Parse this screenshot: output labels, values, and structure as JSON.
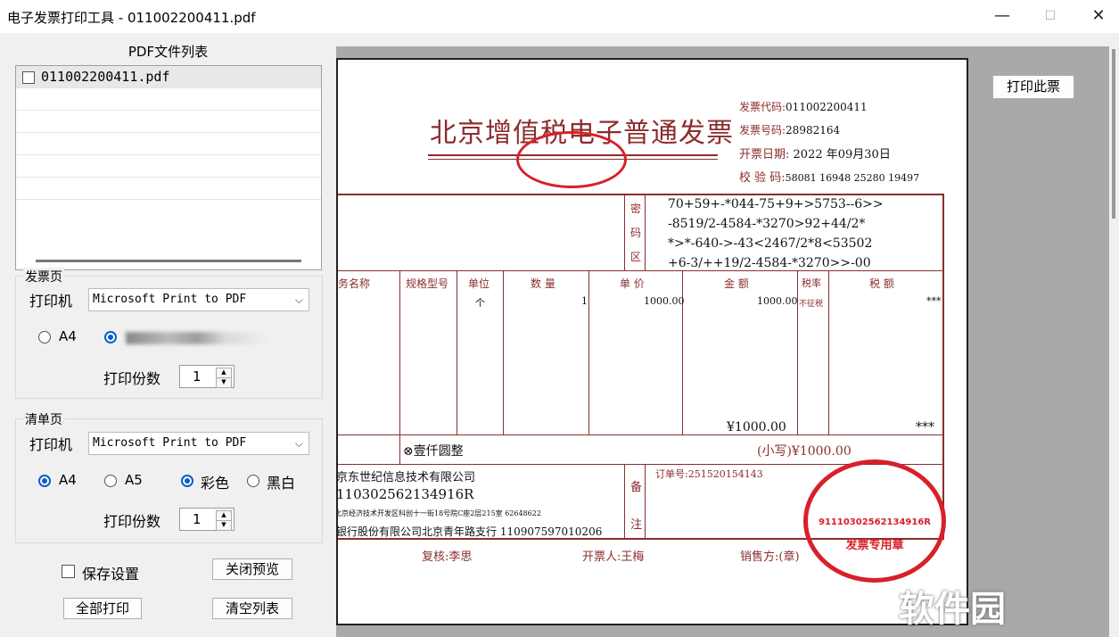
{
  "window": {
    "title": "电子发票打印工具 - 011002200411.pdf",
    "minimize": "—",
    "maximize": "☐",
    "close": "✕"
  },
  "file_list": {
    "title": "PDF文件列表",
    "items": [
      {
        "label": "011002200411.pdf",
        "checked": false
      }
    ]
  },
  "invoice_page": {
    "group_label": "发票页",
    "printer_label": "打印机",
    "printer_value": "Microsoft Print to PDF",
    "paper_options": [
      "A4"
    ],
    "copies_label": "打印份数",
    "copies_value": "1"
  },
  "list_page": {
    "group_label": "清单页",
    "printer_label": "打印机",
    "printer_value": "Microsoft Print to PDF",
    "paper_options": [
      "A4",
      "A5"
    ],
    "color_options": [
      "彩色",
      "黑白"
    ],
    "copies_label": "打印份数",
    "copies_value": "1"
  },
  "actions": {
    "save_settings": "保存设置",
    "close_preview": "关闭预览",
    "print_all": "全部打印",
    "clear_list": "清空列表",
    "print_this": "打印此票"
  },
  "invoice": {
    "title": "北京增值税电子普通发票",
    "code_label": "发票代码:",
    "code": "011002200411",
    "number_label": "发票号码:",
    "number": "28982164",
    "date_label": "开票日期:",
    "date": "2022 年09月30日",
    "check_label": "校 验 码:",
    "check": "58081 16948 25280 19497",
    "cipher_label": [
      "密",
      "码",
      "区"
    ],
    "cipher": [
      "70+59+-*044-75+9+>5753--6>>",
      "-8519/2-4584-*3270>92+44/2*",
      "*>*-640->-43<2467/2*8<53502",
      "+6-3/++19/2-4584-*3270>>-00"
    ],
    "headers": [
      "务名称",
      "规格型号",
      "单位",
      "数 量",
      "单 价",
      "金 额",
      "税率",
      "税 额"
    ],
    "unit": "个",
    "qty": "1",
    "price": "1000.00",
    "amount": "1000.00",
    "rate": "不征税",
    "tax": "***",
    "total_amount": "¥1000.00",
    "total_tax": "***",
    "total_words": "⊗壹仟圆整",
    "total_small": "(小写)¥1000.00",
    "seller_name": "京东世纪信息技术有限公司",
    "seller_tax_id": "11030256213491​6R",
    "seller_addr": "北京经济技术开发区科创十一街18号院C座2层215室 62648622",
    "seller_bank": "银行股份有限公司北京青年路支行 110907597010206",
    "remark_label": [
      "备",
      "注"
    ],
    "order_no": "订单号:251520154143",
    "reviewer": "复核:李思",
    "issuer": "开票人:王梅",
    "seller_label": "销售方:(章)",
    "seal_text": "91110302562134916R",
    "seal_bottom": "发票专用章"
  },
  "watermark": "软件园"
}
